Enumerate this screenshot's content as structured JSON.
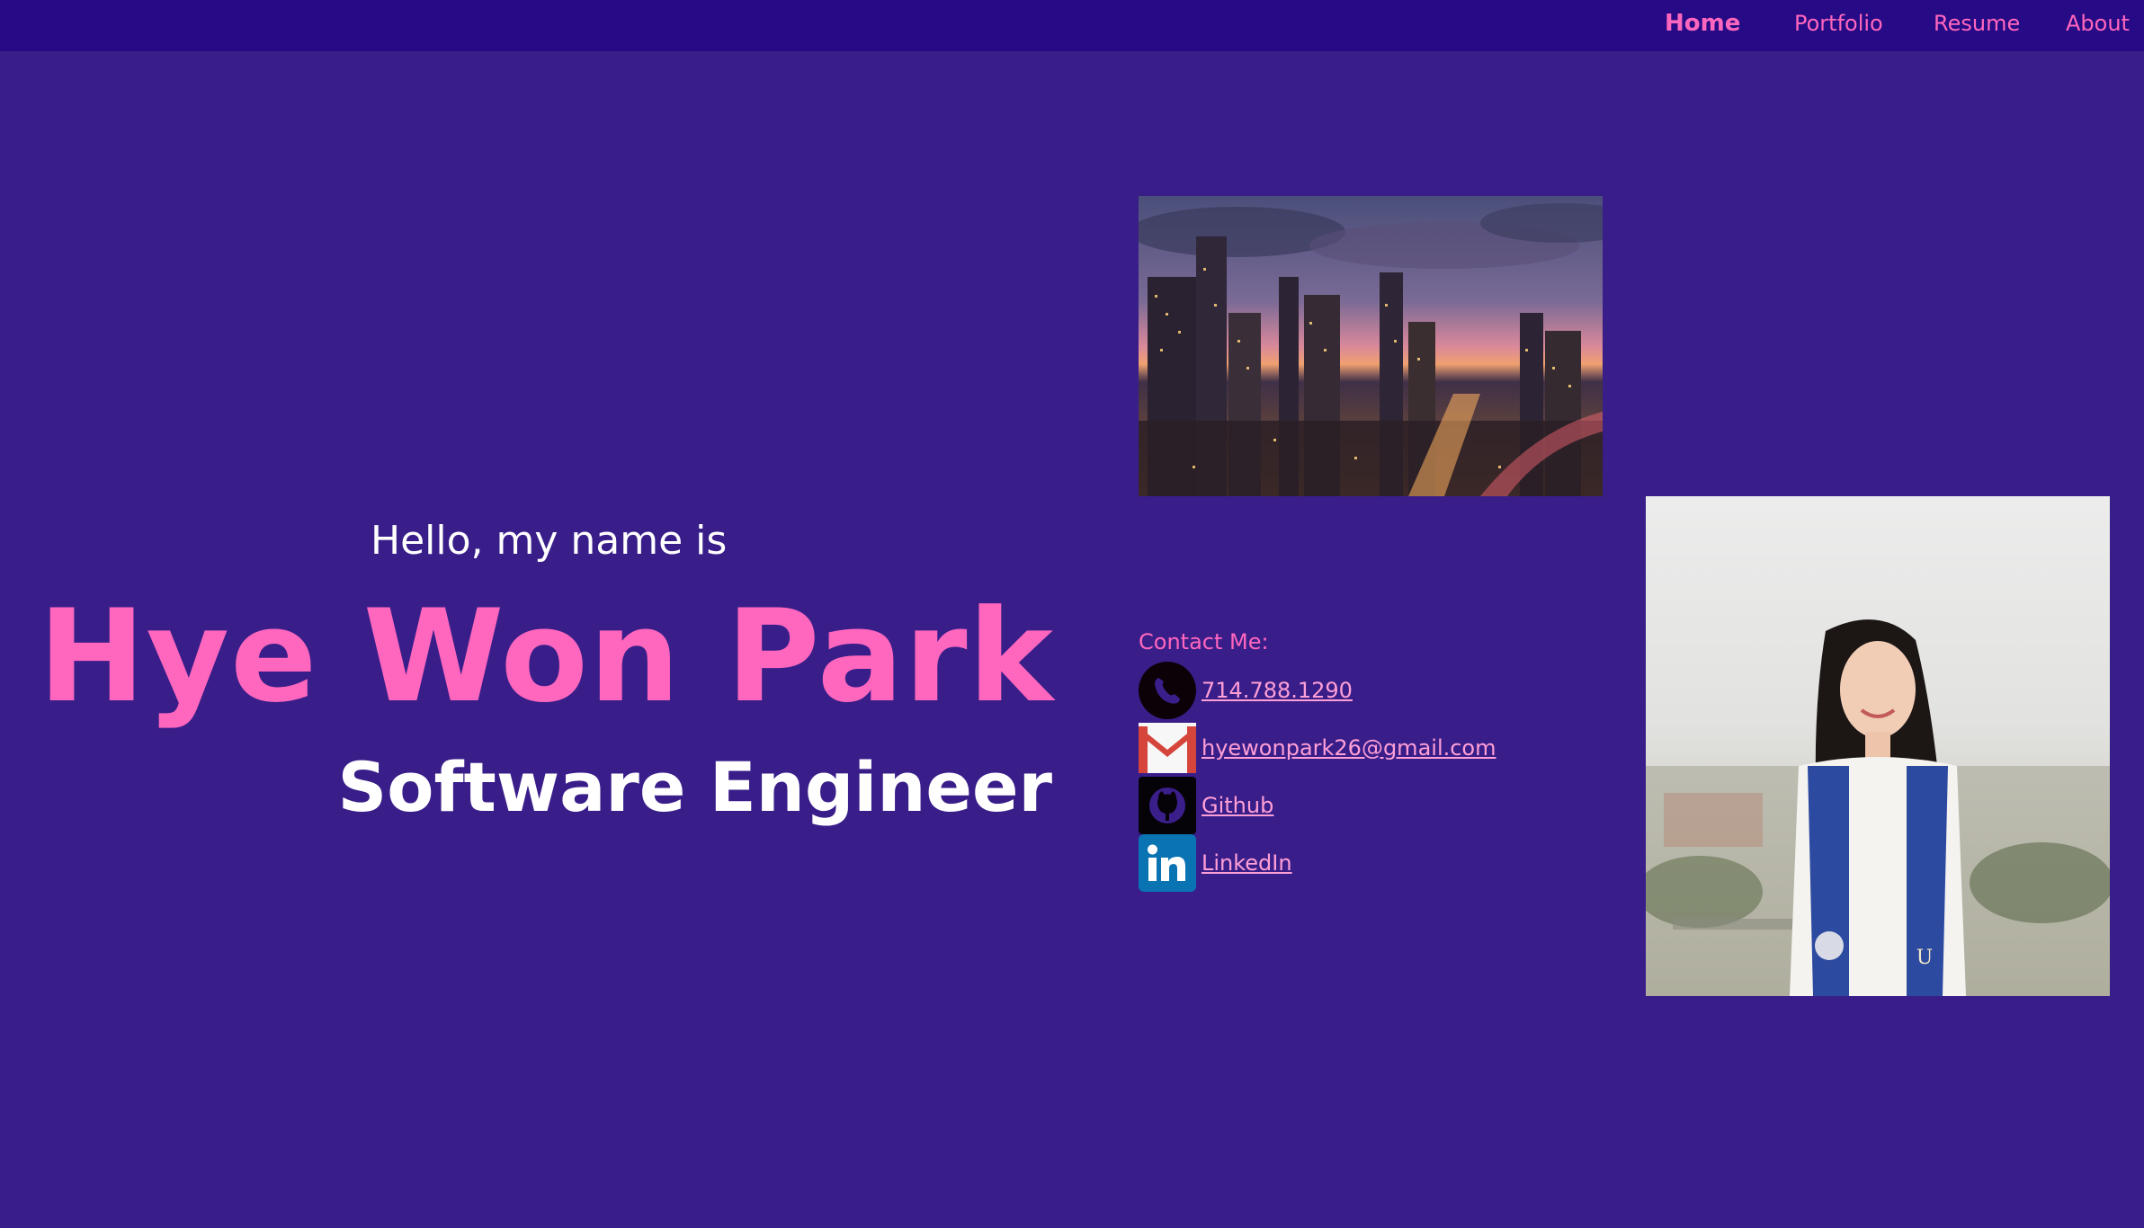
{
  "nav": {
    "items": [
      {
        "label": "Home",
        "active": true
      },
      {
        "label": "Portfolio",
        "active": false
      },
      {
        "label": "Resume",
        "active": false
      },
      {
        "label": "About",
        "active": false
      }
    ]
  },
  "hero": {
    "greeting": "Hello, my name is",
    "name": "Hye Won Park",
    "title": "Software Engineer"
  },
  "contact": {
    "heading": "Contact Me:",
    "items": [
      {
        "icon": "phone-icon",
        "label": "714.788.1290"
      },
      {
        "icon": "gmail-icon",
        "label": "hyewonpark26@gmail.com"
      },
      {
        "icon": "github-icon",
        "label": "Github"
      },
      {
        "icon": "linkedin-icon",
        "label": "LinkedIn"
      }
    ]
  },
  "colors": {
    "background": "#391e8a",
    "navbar": "#260a86",
    "accent_pink": "#ff66bd",
    "link_pink": "#ff9fd6",
    "text_white": "#ffffff"
  }
}
